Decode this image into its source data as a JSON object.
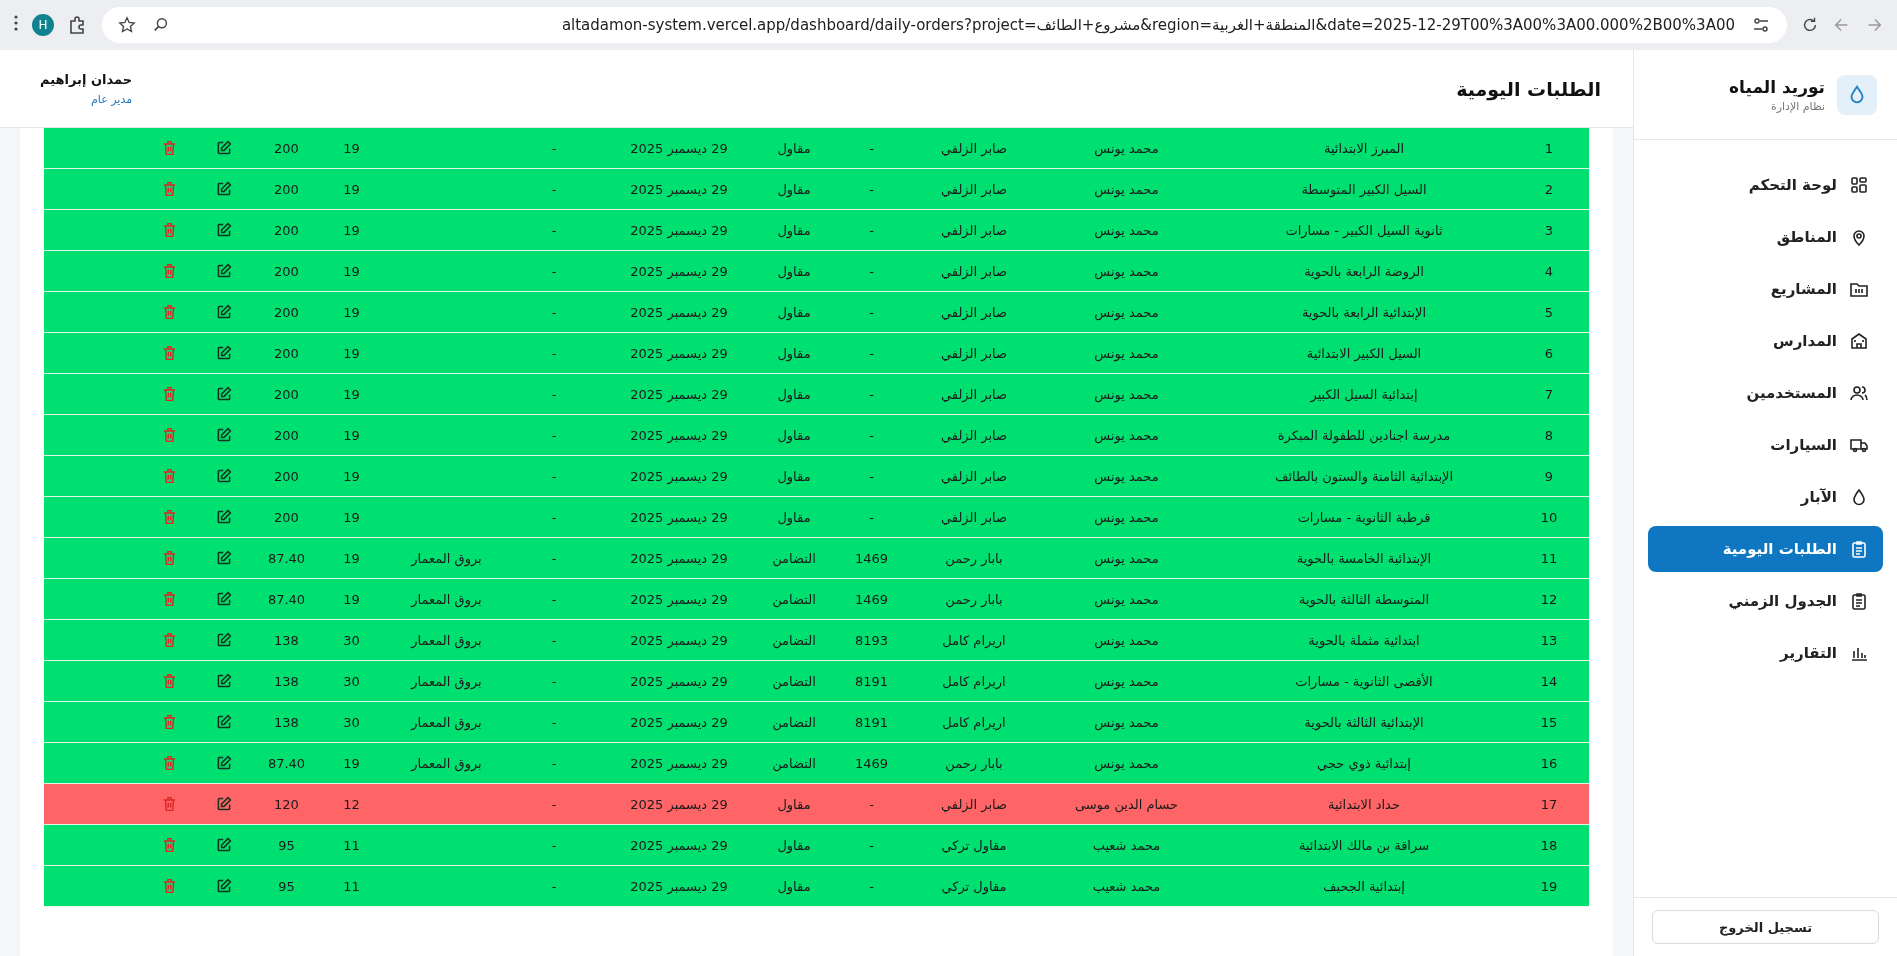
{
  "browser": {
    "avatar": "H",
    "url": "altadamon-system.vercel.app/dashboard/daily-orders?project=مشروع+الطائف&region=المنطقة+الغربية&date=2025-12-29T00%3A00%3A00.000%2B00%3A00"
  },
  "sidebar": {
    "brand": "توريد المياه",
    "subtitle": "نظام الإدارة",
    "items": [
      {
        "label": "لوحة التحكم",
        "selected": false
      },
      {
        "label": "المناطق",
        "selected": false
      },
      {
        "label": "المشاريع",
        "selected": false
      },
      {
        "label": "المدارس",
        "selected": false
      },
      {
        "label": "المستخدمين",
        "selected": false
      },
      {
        "label": "السيارات",
        "selected": false
      },
      {
        "label": "الآبار",
        "selected": false
      },
      {
        "label": "الطلبات اليومية",
        "selected": true
      },
      {
        "label": "الجدول الزمني",
        "selected": false
      },
      {
        "label": "التقارير",
        "selected": false
      }
    ],
    "logout": "تسجيل الخروج"
  },
  "header": {
    "title": "الطلبات اليومية",
    "user_name": "حمدان إبراهيم",
    "user_role": "مدير عام"
  },
  "table": {
    "rows": [
      {
        "index": "1",
        "school": "المبرز الابتدائية",
        "supervisor": "محمد يونس",
        "driver": "صابر الزلفي",
        "car": "-",
        "contractor": "مقاول",
        "date": "29 ديسمبر 2025",
        "column_8": "-",
        "company": "",
        "quantity": "19",
        "amount": "200",
        "color": "#00e070"
      },
      {
        "index": "2",
        "school": "السيل الكبير المتوسطة",
        "supervisor": "محمد يونس",
        "driver": "صابر الزلفي",
        "car": "-",
        "contractor": "مقاول",
        "date": "29 ديسمبر 2025",
        "column_8": "-",
        "company": "",
        "quantity": "19",
        "amount": "200",
        "color": "#00e070"
      },
      {
        "index": "3",
        "school": "ثانوية السيل الكبير - مسارات",
        "supervisor": "محمد يونس",
        "driver": "صابر الزلفي",
        "car": "-",
        "contractor": "مقاول",
        "date": "29 ديسمبر 2025",
        "column_8": "-",
        "company": "",
        "quantity": "19",
        "amount": "200",
        "color": "#00e070"
      },
      {
        "index": "4",
        "school": "الروضة الرابعة بالحوية",
        "supervisor": "محمد يونس",
        "driver": "صابر الزلفي",
        "car": "-",
        "contractor": "مقاول",
        "date": "29 ديسمبر 2025",
        "column_8": "-",
        "company": "",
        "quantity": "19",
        "amount": "200",
        "color": "#00e070"
      },
      {
        "index": "5",
        "school": "الإبتدائية الرابعة بالحوية",
        "supervisor": "محمد يونس",
        "driver": "صابر الزلفي",
        "car": "-",
        "contractor": "مقاول",
        "date": "29 ديسمبر 2025",
        "column_8": "-",
        "company": "",
        "quantity": "19",
        "amount": "200",
        "color": "#00e070"
      },
      {
        "index": "6",
        "school": "السيل الكبير الابتدائية",
        "supervisor": "محمد يونس",
        "driver": "صابر الزلفي",
        "car": "-",
        "contractor": "مقاول",
        "date": "29 ديسمبر 2025",
        "column_8": "-",
        "company": "",
        "quantity": "19",
        "amount": "200",
        "color": "#00e070"
      },
      {
        "index": "7",
        "school": "إبتدائية السيل الكبير",
        "supervisor": "محمد يونس",
        "driver": "صابر الزلفي",
        "car": "-",
        "contractor": "مقاول",
        "date": "29 ديسمبر 2025",
        "column_8": "-",
        "company": "",
        "quantity": "19",
        "amount": "200",
        "color": "#00e070"
      },
      {
        "index": "8",
        "school": "مدرسة اجنادين للطفولة المبكرة",
        "supervisor": "محمد يونس",
        "driver": "صابر الزلفي",
        "car": "-",
        "contractor": "مقاول",
        "date": "29 ديسمبر 2025",
        "column_8": "-",
        "company": "",
        "quantity": "19",
        "amount": "200",
        "color": "#00e070"
      },
      {
        "index": "9",
        "school": "الإبتدائية الثامنة والستون بالطائف",
        "supervisor": "محمد يونس",
        "driver": "صابر الزلفي",
        "car": "-",
        "contractor": "مقاول",
        "date": "29 ديسمبر 2025",
        "column_8": "-",
        "company": "",
        "quantity": "19",
        "amount": "200",
        "color": "#00e070"
      },
      {
        "index": "10",
        "school": "قرطبة الثانوية - مسارات",
        "supervisor": "محمد يونس",
        "driver": "صابر الزلفي",
        "car": "-",
        "contractor": "مقاول",
        "date": "29 ديسمبر 2025",
        "column_8": "-",
        "company": "",
        "quantity": "19",
        "amount": "200",
        "color": "#00e070"
      },
      {
        "index": "11",
        "school": "الإبتدائية الخامسة بالحوية",
        "supervisor": "محمد يونس",
        "driver": "بابار رحمن",
        "car": "1469",
        "contractor": "التضامن",
        "date": "29 ديسمبر 2025",
        "column_8": "-",
        "company": "بروق المعمار",
        "quantity": "19",
        "amount": "87.40",
        "color": "#00e070"
      },
      {
        "index": "12",
        "school": "المتوسطة الثالثة بالحوية",
        "supervisor": "محمد يونس",
        "driver": "بابار رحمن",
        "car": "1469",
        "contractor": "التضامن",
        "date": "29 ديسمبر 2025",
        "column_8": "-",
        "company": "بروق المعمار",
        "quantity": "19",
        "amount": "87.40",
        "color": "#00e070"
      },
      {
        "index": "13",
        "school": "ابتدائية مثملة بالحوية",
        "supervisor": "محمد يونس",
        "driver": "اريرام كامل",
        "car": "8193",
        "contractor": "التضامن",
        "date": "29 ديسمبر 2025",
        "column_8": "-",
        "company": "بروق المعمار",
        "quantity": "30",
        "amount": "138",
        "color": "#00e070"
      },
      {
        "index": "14",
        "school": "الأقصى الثانوية - مسارات",
        "supervisor": "محمد يونس",
        "driver": "اريرام كامل",
        "car": "8191",
        "contractor": "التضامن",
        "date": "29 ديسمبر 2025",
        "column_8": "-",
        "company": "بروق المعمار",
        "quantity": "30",
        "amount": "138",
        "color": "#00e070"
      },
      {
        "index": "15",
        "school": "الإبتدائية الثالثة بالحوية",
        "supervisor": "محمد يونس",
        "driver": "اريرام كامل",
        "car": "8191",
        "contractor": "التضامن",
        "date": "29 ديسمبر 2025",
        "column_8": "-",
        "company": "بروق المعمار",
        "quantity": "30",
        "amount": "138",
        "color": "#00e070"
      },
      {
        "index": "16",
        "school": "إبتدائية ذوي حجي",
        "supervisor": "محمد يونس",
        "driver": "بابار رحمن",
        "car": "1469",
        "contractor": "التضامن",
        "date": "29 ديسمبر 2025",
        "column_8": "-",
        "company": "بروق المعمار",
        "quantity": "19",
        "amount": "87.40",
        "color": "#00e070"
      },
      {
        "index": "17",
        "school": "حداد الابتدائية",
        "supervisor": "حسام الدين موسى",
        "driver": "صابر الزلفي",
        "car": "-",
        "contractor": "مقاول",
        "date": "29 ديسمبر 2025",
        "column_8": "-",
        "company": "",
        "quantity": "12",
        "amount": "120",
        "color": "#ff6467"
      },
      {
        "index": "18",
        "school": "سراقة بن مالك الابتدائية",
        "supervisor": "محمد شعيب",
        "driver": "مقاول تركي",
        "car": "-",
        "contractor": "مقاول",
        "date": "29 ديسمبر 2025",
        "column_8": "-",
        "company": "",
        "quantity": "11",
        "amount": "95",
        "color": "#00e070"
      },
      {
        "index": "19",
        "school": "إبتدائية الجحيف",
        "supervisor": "محمد شعيب",
        "driver": "مقاول تركي",
        "car": "-",
        "contractor": "مقاول",
        "date": "29 ديسمبر 2025",
        "column_8": "-",
        "company": "",
        "quantity": "11",
        "amount": "95",
        "color": "#00e070"
      }
    ]
  }
}
